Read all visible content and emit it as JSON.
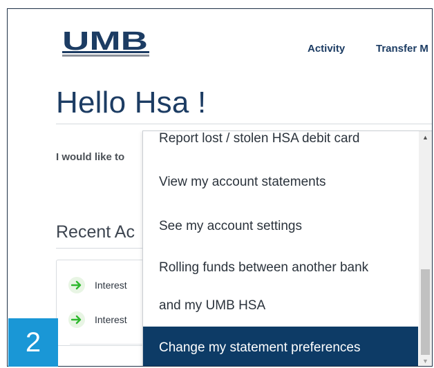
{
  "brand": {
    "logo_text": "UMB",
    "color": "#1c3c63"
  },
  "nav": {
    "activity": "Activity",
    "transfer": "Transfer M"
  },
  "greeting": "Hello Hsa !",
  "would_like": "I would like to",
  "recent": {
    "title": "Recent Ac",
    "items": [
      {
        "label": "Interest",
        "icon": "arrow-right-icon"
      },
      {
        "label": "Interest",
        "icon": "arrow-right-icon"
      }
    ]
  },
  "dropdown": {
    "items": [
      {
        "label": "Report lost / stolen HSA debit card"
      },
      {
        "label": "View my account statements"
      },
      {
        "label": "See my account settings"
      },
      {
        "label": "Rolling funds between another bank"
      },
      {
        "label": "and my UMB HSA"
      },
      {
        "label": "Change my statement preferences",
        "selected": true
      }
    ],
    "selected_color": "#0d3b66"
  },
  "step_badge": "2",
  "colors": {
    "accent": "#1a97d6",
    "heading": "#1c3c63",
    "success_arrow": "#2eb82e"
  }
}
